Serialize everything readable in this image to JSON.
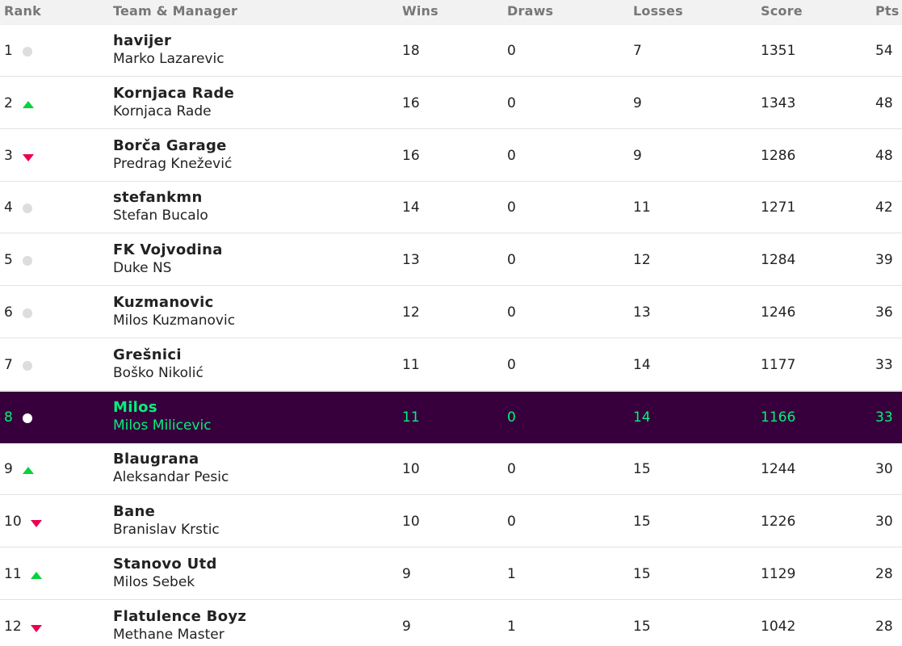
{
  "columns": {
    "rank": "Rank",
    "team_manager": "Team & Manager",
    "wins": "Wins",
    "draws": "Draws",
    "losses": "Losses",
    "score": "Score",
    "pts": "Pts"
  },
  "colors": {
    "highlight_bg": "#37003c",
    "highlight_text": "#05f07b",
    "up": "#05d23c",
    "down": "#e90052",
    "same": "#dddddd"
  },
  "rows": [
    {
      "rank": "1",
      "movement": "same",
      "team": "havijer",
      "manager": "Marko Lazarevic",
      "wins": "18",
      "draws": "0",
      "losses": "7",
      "score": "1351",
      "pts": "54",
      "highlight": false
    },
    {
      "rank": "2",
      "movement": "up",
      "team": "Kornjaca Rade",
      "manager": "Kornjaca Rade",
      "wins": "16",
      "draws": "0",
      "losses": "9",
      "score": "1343",
      "pts": "48",
      "highlight": false
    },
    {
      "rank": "3",
      "movement": "down",
      "team": "Borča Garage",
      "manager": "Predrag Knežević",
      "wins": "16",
      "draws": "0",
      "losses": "9",
      "score": "1286",
      "pts": "48",
      "highlight": false
    },
    {
      "rank": "4",
      "movement": "same",
      "team": "stefankmn",
      "manager": "Stefan Bucalo",
      "wins": "14",
      "draws": "0",
      "losses": "11",
      "score": "1271",
      "pts": "42",
      "highlight": false
    },
    {
      "rank": "5",
      "movement": "same",
      "team": "FK Vojvodina",
      "manager": "Duke NS",
      "wins": "13",
      "draws": "0",
      "losses": "12",
      "score": "1284",
      "pts": "39",
      "highlight": false
    },
    {
      "rank": "6",
      "movement": "same",
      "team": "Kuzmanovic",
      "manager": "Milos Kuzmanovic",
      "wins": "12",
      "draws": "0",
      "losses": "13",
      "score": "1246",
      "pts": "36",
      "highlight": false
    },
    {
      "rank": "7",
      "movement": "same",
      "team": "Grešnici",
      "manager": "Boško Nikolić",
      "wins": "11",
      "draws": "0",
      "losses": "14",
      "score": "1177",
      "pts": "33",
      "highlight": false
    },
    {
      "rank": "8",
      "movement": "same",
      "team": "Milos",
      "manager": "Milos Milicevic",
      "wins": "11",
      "draws": "0",
      "losses": "14",
      "score": "1166",
      "pts": "33",
      "highlight": true
    },
    {
      "rank": "9",
      "movement": "up",
      "team": "Blaugrana",
      "manager": "Aleksandar Pesic",
      "wins": "10",
      "draws": "0",
      "losses": "15",
      "score": "1244",
      "pts": "30",
      "highlight": false
    },
    {
      "rank": "10",
      "movement": "down",
      "team": "Bane",
      "manager": "Branislav Krstic",
      "wins": "10",
      "draws": "0",
      "losses": "15",
      "score": "1226",
      "pts": "30",
      "highlight": false
    },
    {
      "rank": "11",
      "movement": "up",
      "team": "Stanovo Utd",
      "manager": "Milos Sebek",
      "wins": "9",
      "draws": "1",
      "losses": "15",
      "score": "1129",
      "pts": "28",
      "highlight": false
    },
    {
      "rank": "12",
      "movement": "down",
      "team": "Flatulence Boyz",
      "manager": "Methane Master",
      "wins": "9",
      "draws": "1",
      "losses": "15",
      "score": "1042",
      "pts": "28",
      "highlight": false
    }
  ]
}
